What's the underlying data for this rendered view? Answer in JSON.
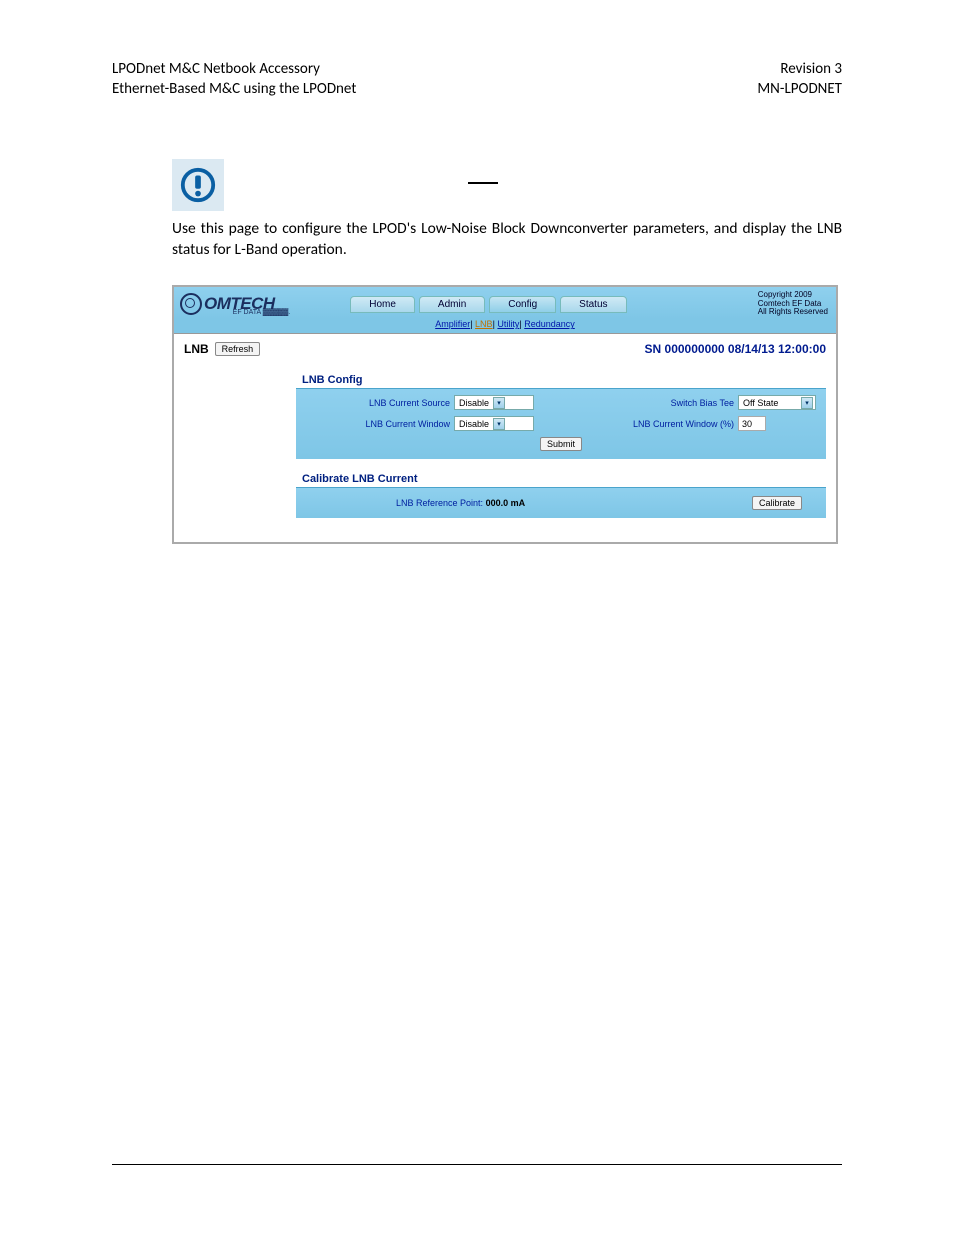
{
  "doc_header": {
    "left1": "LPODnet M&C Netbook Accessory",
    "left2": "Ethernet-Based M&C using the LPODnet",
    "right1": "Revision 3",
    "right2": "MN-LPODNET"
  },
  "intro": "Use this page to configure the LPOD's Low-Noise Block Downconverter parameters, and display the LNB status for L-Band operation.",
  "logo_text": "OMTECH",
  "logo_sub": "EF DATA ▓▓▓▓▓.",
  "tabs": {
    "home": "Home",
    "admin": "Admin",
    "config": "Config",
    "status": "Status"
  },
  "copyright": {
    "l1": "Copyright 2009",
    "l2": "Comtech EF Data",
    "l3": "All Rights Reserved"
  },
  "subnav": {
    "amplifier": "Amplifier",
    "lnb": "LNB",
    "utility": "Utility",
    "redundancy": "Redundancy"
  },
  "page_title": "LNB",
  "refresh": "Refresh",
  "sn_line": "SN 000000000 08/14/13 12:00:00",
  "panel1": {
    "title": "LNB Config",
    "f1_label": "LNB Current Source",
    "f1_value": "Disable",
    "f2_label": "Switch Bias Tee",
    "f2_value": "Off State",
    "f3_label": "LNB Current Window",
    "f3_value": "Disable",
    "f4_label": "LNB Current Window (%)",
    "f4_value": "30",
    "submit": "Submit"
  },
  "panel2": {
    "title": "Calibrate LNB Current",
    "ref_label": "LNB Reference Point:",
    "ref_value": "000.0 mA",
    "calibrate": "Calibrate"
  }
}
